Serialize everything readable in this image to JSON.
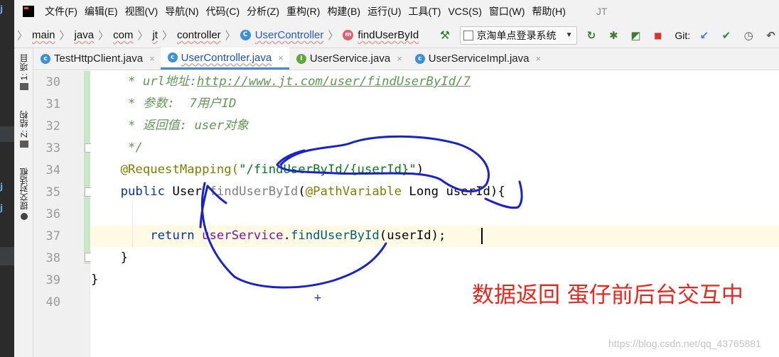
{
  "menubar": {
    "items": [
      "文件(F)",
      "编辑(E)",
      "视图(V)",
      "导航(N)",
      "代码(C)",
      "分析(Z)",
      "重构(R)",
      "构建(B)",
      "运行(U)",
      "工具(T)",
      "VCS(S)",
      "窗口(W)",
      "帮助(H)"
    ],
    "window_title": "JT"
  },
  "breadcrumb": {
    "items": [
      "main",
      "java",
      "com",
      "jt",
      "controller"
    ],
    "class_name": "UserController",
    "method_name": "findUserById"
  },
  "toolbar": {
    "run_config": "京淘单点登录系统",
    "git_label": "Git:"
  },
  "tool_windows": {
    "project": "1: 项目",
    "structure": "Z: 结构",
    "commit": "提交对话框"
  },
  "tabs": [
    {
      "label": "TestHttpClient.java",
      "icon": "c-class-icon",
      "active": false
    },
    {
      "label": "UserController.java",
      "icon": "c-class-icon",
      "active": true
    },
    {
      "label": "UserService.java",
      "icon": "interface-icon",
      "active": false
    },
    {
      "label": "UserServiceImpl.java",
      "icon": "c-class-icon",
      "active": false
    }
  ],
  "editor": {
    "line_numbers": [
      "30",
      "31",
      "32",
      "33",
      "34",
      "35",
      "36",
      "37",
      "38",
      "39",
      "40"
    ],
    "code": {
      "l30_prefix": "     * url地址:",
      "l30_link": "http://www.jt.com/user/findUserById/7",
      "l31": "     * 参数:  7用户ID",
      "l32": "     * 返回值: user对象",
      "l33": "     */",
      "l34_anno": "    @RequestMapping(",
      "l34_str": "\"/findUserById/{userId}\"",
      "l34_end": ")",
      "l35_kw": "    public ",
      "l35_type": "User ",
      "l35_name": "findUserById",
      "l35_paren": "(",
      "l35_anno": "@PathVariable ",
      "l35_ptype": "Long ",
      "l35_param": "userId",
      "l35_end": "){",
      "l37_kw": "        return ",
      "l37_field": "userService",
      "l37_dot": ".",
      "l37_call": "findUserById",
      "l37_args": "(userId);",
      "l38": "    }",
      "l39": "}"
    }
  },
  "annotation": {
    "text": "数据返回 蛋仔前后台交互中",
    "color": "#e8261c",
    "ink_color": "#1a23c8"
  },
  "watermark": "https://blog.csdn.net/qq_43765881"
}
